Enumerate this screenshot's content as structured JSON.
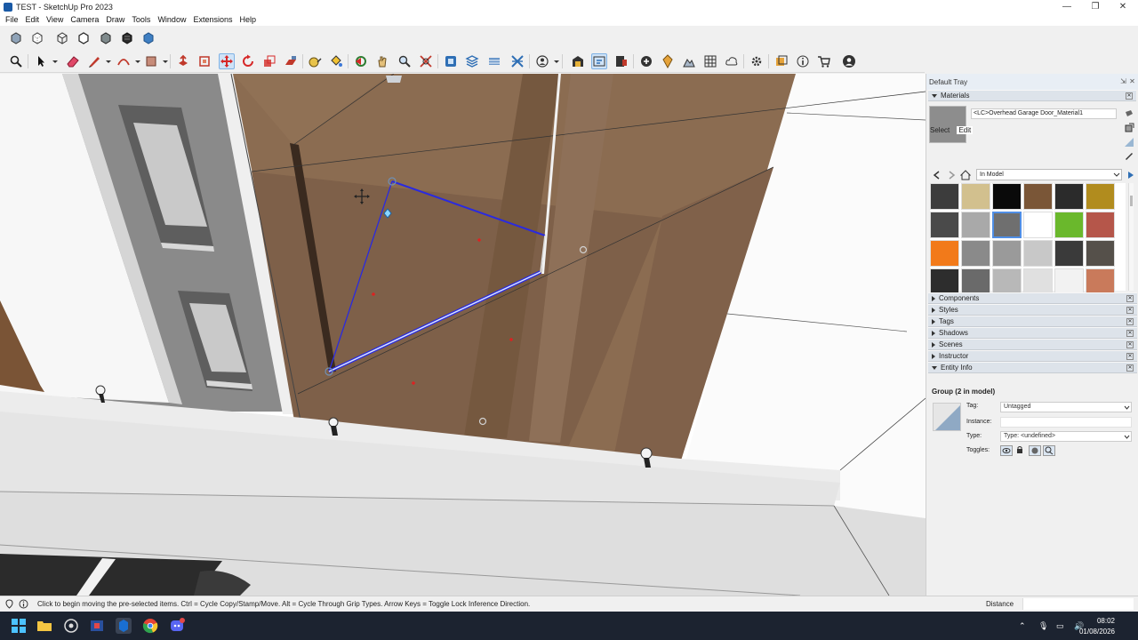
{
  "window": {
    "title": "TEST - SketchUp Pro 2023",
    "controls": [
      "—",
      "❐",
      "✕"
    ]
  },
  "menu": [
    "File",
    "Edit",
    "View",
    "Camera",
    "Draw",
    "Tools",
    "Window",
    "Extensions",
    "Help"
  ],
  "toolbar_styles": [
    {
      "icon": "xray-style-icon"
    },
    {
      "icon": "back-edges-style-icon"
    },
    {
      "icon": "wireframe-style-icon"
    },
    {
      "icon": "hidden-line-style-icon"
    },
    {
      "icon": "shaded-style-icon"
    },
    {
      "icon": "shaded-textures-style-icon"
    },
    {
      "icon": "monochrome-style-icon"
    }
  ],
  "toolbar_tools": [
    {
      "icon": "search-icon"
    },
    {
      "icon": "select-arrow-icon"
    },
    {
      "icon": "eraser-icon"
    },
    {
      "icon": "pencil-line-icon"
    },
    {
      "icon": "arc-icon"
    },
    {
      "icon": "rectangle-shape-icon"
    },
    {
      "icon": "push-pull-icon"
    },
    {
      "icon": "offset-icon"
    },
    {
      "icon": "move-icon",
      "active": true
    },
    {
      "icon": "rotate-icon"
    },
    {
      "icon": "scale-icon"
    },
    {
      "icon": "follow-me-icon"
    },
    {
      "icon": "tape-measure-icon"
    },
    {
      "icon": "paint-bucket-icon"
    },
    {
      "icon": "orbit-icon"
    },
    {
      "icon": "pan-icon"
    },
    {
      "icon": "zoom-icon"
    },
    {
      "icon": "zoom-extents-icon"
    },
    {
      "icon": "solid-tools-icon"
    },
    {
      "icon": "sandbox-icon"
    },
    {
      "icon": "section-plane-icon"
    },
    {
      "icon": "intersect-icon"
    },
    {
      "icon": "user-account-icon"
    },
    {
      "icon": "warehouse-icon"
    },
    {
      "icon": "extension-warehouse-icon"
    },
    {
      "icon": "layout-send-icon"
    },
    {
      "icon": "add-location-icon"
    },
    {
      "icon": "geo-icon"
    },
    {
      "icon": "terrain-icon"
    },
    {
      "icon": "photo-texture-icon"
    },
    {
      "icon": "cloud-icon"
    },
    {
      "icon": "settings-icon"
    },
    {
      "icon": "dynamic-components-icon"
    },
    {
      "icon": "info-icon"
    },
    {
      "icon": "cart-icon"
    },
    {
      "icon": "profile-icon"
    }
  ],
  "tray": {
    "title": "Default Tray",
    "materials": {
      "header": "Materials",
      "current_name": "<LC>Overhead Garage Door_Material1",
      "current_color": "#8d8d8d",
      "tabs": [
        "Select",
        "Edit"
      ],
      "collection": "In Model",
      "swatches": [
        "#3c3c3c",
        "#d2c08e",
        "#0a0a0a",
        "#7a5637",
        "#2b2b2b",
        "#b18c1e",
        "#4a4a4a",
        "#a9a9a9",
        "#6f6f6f",
        "#ffffff",
        "#6ab82c",
        "#b5564a",
        "#f27a1a",
        "#8a8a8a",
        "#9a9a9a",
        "#c8c8c8",
        "#3a3a3a",
        "#55504a",
        "#2d2d2d",
        "#6a6a6a",
        "#b8b8b8",
        "#e0e0e0",
        "#f2f2f2",
        "#c97a5b"
      ],
      "selected_swatch": 8
    },
    "panels": [
      "Components",
      "Styles",
      "Tags",
      "Shadows",
      "Scenes",
      "Instructor",
      "Entity Info"
    ],
    "entity_info": {
      "title": "Group (2 in model)",
      "tag_label": "Tag:",
      "tag_value": "Untagged",
      "instance_label": "Instance:",
      "instance_value": "",
      "type_label": "Type:",
      "type_value": "Type: <undefined>",
      "toggles_label": "Toggles:"
    }
  },
  "status": {
    "message": "Click to begin moving the pre-selected items.  Ctrl = Cycle Copy/Stamp/Move.  Alt = Cycle Through Grip Types.  Arrow Keys = Toggle Lock Inference Direction.",
    "vcb_label": "Distance",
    "vcb_value": ""
  },
  "taskbar": {
    "time": "08:02",
    "date": "01/08/2026"
  }
}
